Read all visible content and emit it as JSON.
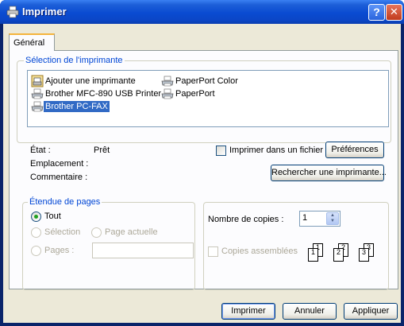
{
  "window": {
    "title": "Imprimer",
    "help_button": "?",
    "close_button": "✕"
  },
  "tabs": [
    {
      "label": "Général",
      "selected": true
    }
  ],
  "printer_selection": {
    "legend": "Sélection de l'imprimante",
    "printers": [
      {
        "name": "Ajouter une imprimante",
        "icon": "add-printer-icon",
        "selected": false
      },
      {
        "name": "PaperPort Color",
        "icon": "printer-icon",
        "selected": false
      },
      {
        "name": "Brother MFC-890 USB Printer",
        "icon": "printer-icon",
        "selected": false
      },
      {
        "name": "PaperPort",
        "icon": "printer-icon",
        "selected": false
      },
      {
        "name": "Brother PC-FAX",
        "icon": "fax-printer-icon",
        "selected": true
      }
    ],
    "status_label": "État :",
    "status_value": "Prêt",
    "location_label": "Emplacement :",
    "location_value": "",
    "comment_label": "Commentaire :",
    "comment_value": "",
    "print_to_file_label": "Imprimer dans un fichier",
    "print_to_file_checked": false,
    "preferences_button": "Préférences",
    "find_printer_button": "Rechercher une imprimante..."
  },
  "page_range": {
    "legend": "Étendue de pages",
    "all_label": "Tout",
    "selection_label": "Sélection",
    "current_page_label": "Page actuelle",
    "pages_label": "Pages :",
    "pages_value": "",
    "selected_option": "Tout"
  },
  "copies": {
    "count_label": "Nombre de copies :",
    "count_value": "1",
    "collate_label": "Copies assemblées",
    "collate_checked": false,
    "collate_enabled": false,
    "page_numbers": [
      "1",
      "1",
      "2",
      "2",
      "3",
      "3"
    ]
  },
  "footer": {
    "print_button": "Imprimer",
    "cancel_button": "Annuler",
    "apply_button": "Appliquer"
  },
  "colors": {
    "titlebar": "#0a4bd1",
    "groupbox_title": "#0046d5",
    "selection": "#316ac5",
    "dialog_bg": "#ece9d8"
  }
}
